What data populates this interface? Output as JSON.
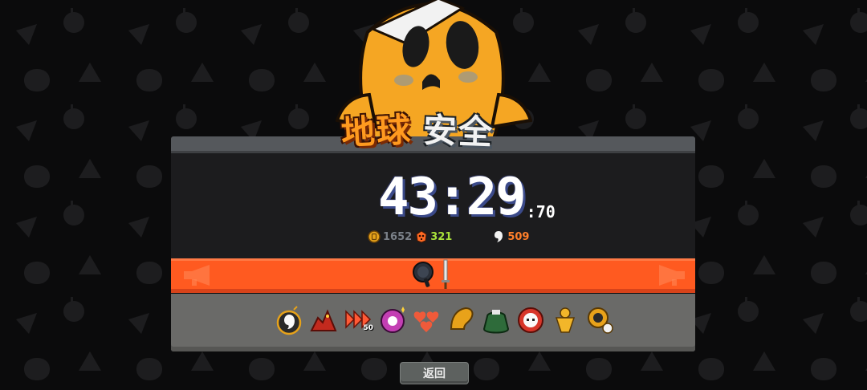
{
  "title": {
    "part1": "地球",
    "part2": "安全"
  },
  "timer": {
    "main": "43:29",
    "ms": ":70"
  },
  "stats": {
    "gold": "1652",
    "kills": "321",
    "souls": "509"
  },
  "colors": {
    "accent_orange": "#ff5a20",
    "panel_dark": "#1c1c1e",
    "mascot_yellow": "#f5a623",
    "kills_green": "#a8e23a",
    "souls_orange": "#ff7f2a"
  },
  "weapons": [
    "frying-pan-icon",
    "sword-icon"
  ],
  "items": [
    {
      "icon": "ghost-bomb-icon"
    },
    {
      "icon": "red-beast-icon"
    },
    {
      "icon": "arrows-icon",
      "badge": "50"
    },
    {
      "icon": "magic-orb-icon"
    },
    {
      "icon": "hearts-icon"
    },
    {
      "icon": "golden-wings-icon"
    },
    {
      "icon": "green-sack-icon"
    },
    {
      "icon": "angry-skull-icon"
    },
    {
      "icon": "golden-figure-icon"
    },
    {
      "icon": "golden-clock-icon"
    }
  ],
  "buttons": {
    "return_label": "返回"
  }
}
